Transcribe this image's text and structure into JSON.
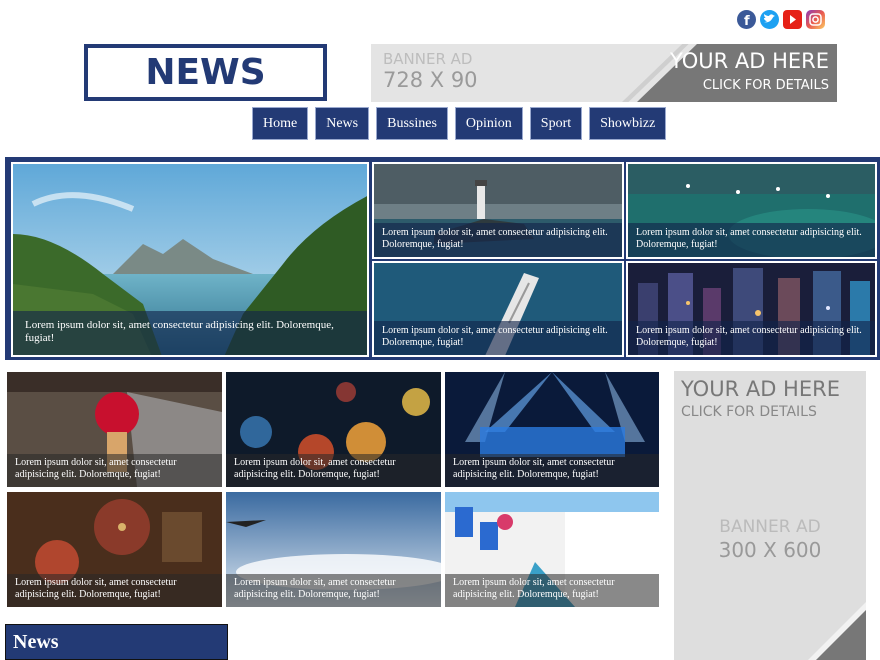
{
  "social": [
    {
      "name": "facebook-icon",
      "color": "#3b5998"
    },
    {
      "name": "twitter-icon",
      "color": "#1da1f2"
    },
    {
      "name": "youtube-icon",
      "color": "#e62117"
    },
    {
      "name": "instagram-icon",
      "color": "#8a3ab9"
    }
  ],
  "logo": {
    "text": "NEWS"
  },
  "banner_top": {
    "label": "BANNER AD",
    "size": "728 X 90",
    "ad_text": "YOUR AD HERE",
    "click_text": "CLICK FOR DETAILS"
  },
  "nav": {
    "items": [
      "Home",
      "News",
      "Bussines",
      "Opinion",
      "Sport",
      "Showbizz"
    ]
  },
  "hero": {
    "big_caption": "Lorem ipsum dolor sit, amet consectetur adipisicing elit. Doloremque, fugiat!",
    "tiles": [
      {
        "caption": "Lorem ipsum dolor sit, amet consectetur adipisicing elit. Doloremque, fugiat!",
        "image": "lighthouse"
      },
      {
        "caption": "Lorem ipsum dolor sit, amet consectetur adipisicing elit. Doloremque, fugiat!",
        "image": "ocean-boats"
      },
      {
        "caption": "Lorem ipsum dolor sit, amet consectetur adipisicing elit. Doloremque, fugiat!",
        "image": "yacht"
      },
      {
        "caption": "Lorem ipsum dolor sit, amet consectetur adipisicing elit. Doloremque, fugiat!",
        "image": "city-night"
      }
    ]
  },
  "grid": {
    "cards": [
      {
        "caption": "Lorem ipsum dolor sit, amet consectetur adipisicing elit. Doloremque, fugiat!",
        "image": "umbrella-street"
      },
      {
        "caption": "Lorem ipsum dolor sit, amet consectetur adipisicing elit. Doloremque, fugiat!",
        "image": "bokeh-lights"
      },
      {
        "caption": "Lorem ipsum dolor sit, amet consectetur adipisicing elit. Doloremque, fugiat!",
        "image": "concert-stage"
      },
      {
        "caption": "Lorem ipsum dolor sit, amet consectetur adipisicing elit. Doloremque, fugiat!",
        "image": "antique-shop"
      },
      {
        "caption": "Lorem ipsum dolor sit, amet consectetur adipisicing elit. Doloremque, fugiat!",
        "image": "airplane-wing"
      },
      {
        "caption": "Lorem ipsum dolor sit, amet consectetur adipisicing elit. Doloremque, fugiat!",
        "image": "white-village"
      }
    ]
  },
  "side_ad": {
    "ad_text": "YOUR AD HERE",
    "click_text": "CLICK FOR DETAILS",
    "label": "BANNER AD",
    "size": "300 X 600"
  },
  "section": {
    "title": "News"
  }
}
